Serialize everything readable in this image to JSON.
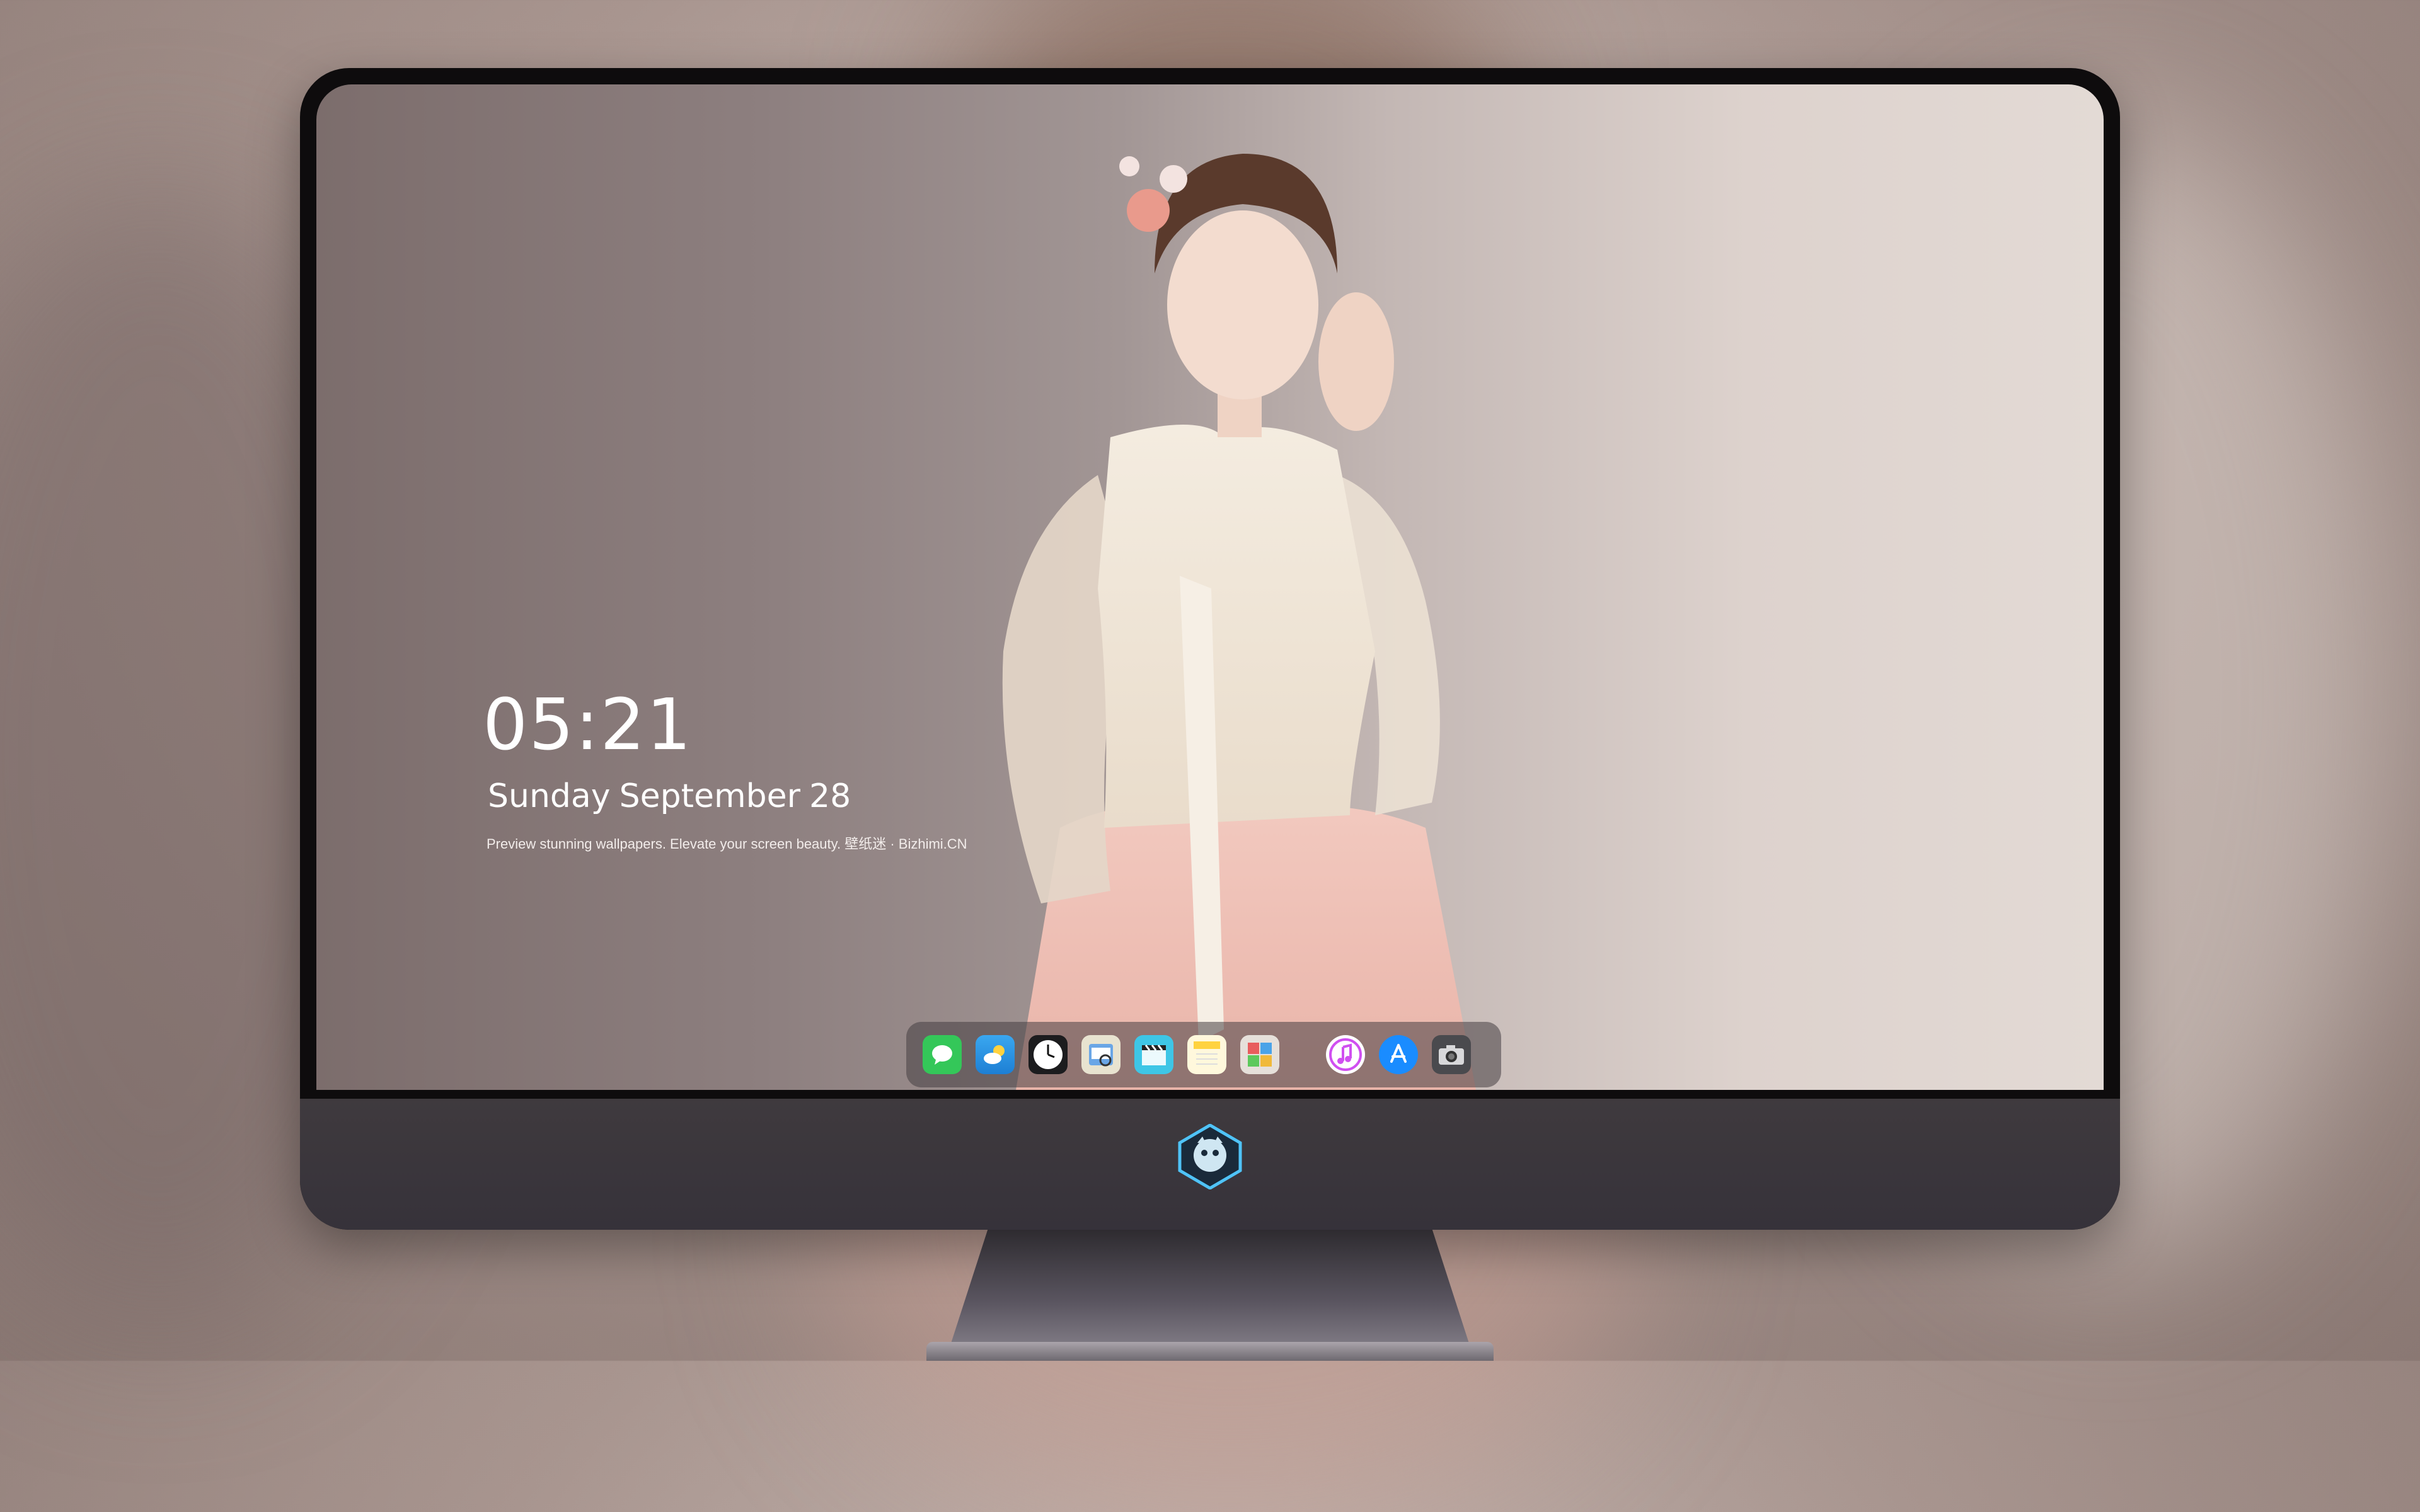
{
  "lock_screen": {
    "time": "05:21",
    "date_weekday": "Sunday",
    "date_month": "September",
    "date_day": "28",
    "tagline": "Preview stunning wallpapers. Elevate your screen beauty. 壁纸迷 · Bizhimi.CN"
  },
  "dock": {
    "apps": [
      {
        "icon": "messages-icon",
        "color": "#34c759"
      },
      {
        "icon": "weather-icon",
        "color": "#2f9be8"
      },
      {
        "icon": "clock-icon",
        "color": "#1c1c1e"
      },
      {
        "icon": "preview-icon",
        "color": "#e8e3d0"
      },
      {
        "icon": "clips-icon",
        "color": "#3ec6e6"
      },
      {
        "icon": "notes-icon",
        "color": "#ffd23f"
      },
      {
        "icon": "photo-booth-icon",
        "color": "#e6e0da"
      },
      {
        "icon": "music-icon",
        "color": "#d04ff0"
      },
      {
        "icon": "app-store-icon",
        "color": "#1a8cff"
      },
      {
        "icon": "camera-icon",
        "color": "#4a4a4e"
      }
    ]
  }
}
